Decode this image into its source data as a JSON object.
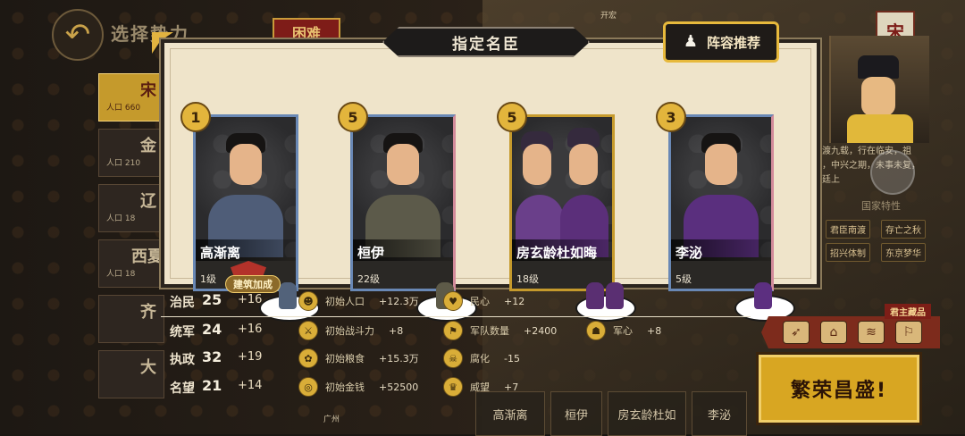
{
  "header": {
    "back_icon": "back-arrow-icon",
    "title": "选择势力",
    "difficulty": "困难"
  },
  "factions": [
    {
      "name": "宋",
      "population": "人口 660"
    },
    {
      "name": "金",
      "population": "人口 210"
    },
    {
      "name": "辽",
      "population": "人口 18"
    },
    {
      "name": "西夏",
      "population": "人口 18"
    },
    {
      "name": "齐",
      "population": ""
    },
    {
      "name": "大",
      "population": ""
    }
  ],
  "dialog": {
    "title": "指定名臣",
    "recommend_label": "阵容推荐",
    "recommend_icon": "chess-pawn-icon",
    "cards": [
      {
        "name": "高渐离",
        "level": "1级",
        "stars": "1"
      },
      {
        "name": "桓伊",
        "level": "22级",
        "stars": "5"
      },
      {
        "name": "房玄龄杜如晦",
        "level": "18级",
        "stars": "5"
      },
      {
        "name": "李泌",
        "level": "5级",
        "stars": "3"
      }
    ]
  },
  "stats": {
    "build_bonus_label": "建筑加成",
    "rows": [
      {
        "name": "治民",
        "value": "25",
        "bonus": "+16",
        "effects": [
          {
            "label": "初始人口",
            "value": "+12.3万",
            "icon": "population-icon"
          },
          {
            "label": "民心",
            "value": "+12",
            "icon": "heart-icon"
          }
        ]
      },
      {
        "name": "统军",
        "value": "24",
        "bonus": "+16",
        "effects": [
          {
            "label": "初始战斗力",
            "value": "+8",
            "icon": "crossbow-icon"
          },
          {
            "label": "军队数量",
            "value": "+2400",
            "icon": "army-icon"
          },
          {
            "label": "军心",
            "value": "+8",
            "icon": "soldier-icon"
          }
        ]
      },
      {
        "name": "执政",
        "value": "32",
        "bonus": "+19",
        "effects": [
          {
            "label": "初始粮食",
            "value": "+15.3万",
            "icon": "grain-icon"
          },
          {
            "label": "腐化",
            "value": "-15",
            "icon": "corruption-icon"
          }
        ]
      },
      {
        "name": "名望",
        "value": "21",
        "bonus": "+14",
        "effects": [
          {
            "label": "初始金钱",
            "value": "+52500",
            "icon": "coin-icon"
          },
          {
            "label": "威望",
            "value": "+7",
            "icon": "prestige-icon"
          }
        ]
      }
    ]
  },
  "bottom_tabs": [
    "高渐离",
    "桓伊",
    "房玄龄杜如",
    "李泌"
  ],
  "right_panel": {
    "flag_char": "宋",
    "lore": "南渡九载，行在临安，祖宗，中兴之期，未事未复，朝廷上"
  },
  "traits": {
    "title": "国家特性",
    "items": [
      "君臣南渡",
      "存亡之秋",
      "招兴体制",
      "东京梦华"
    ]
  },
  "treasures": {
    "label": "君主藏品",
    "icons": [
      "bow-icon",
      "palace-icon",
      "scroll-icon",
      "banner-icon"
    ]
  },
  "prosper_button": "繁荣昌盛!",
  "map_labels": [
    "广州",
    "开宏"
  ],
  "colors": {
    "accent_gold": "#e3b53c",
    "dialog_bg": "#efe4ca",
    "difficulty_red": "#7e1c18"
  }
}
